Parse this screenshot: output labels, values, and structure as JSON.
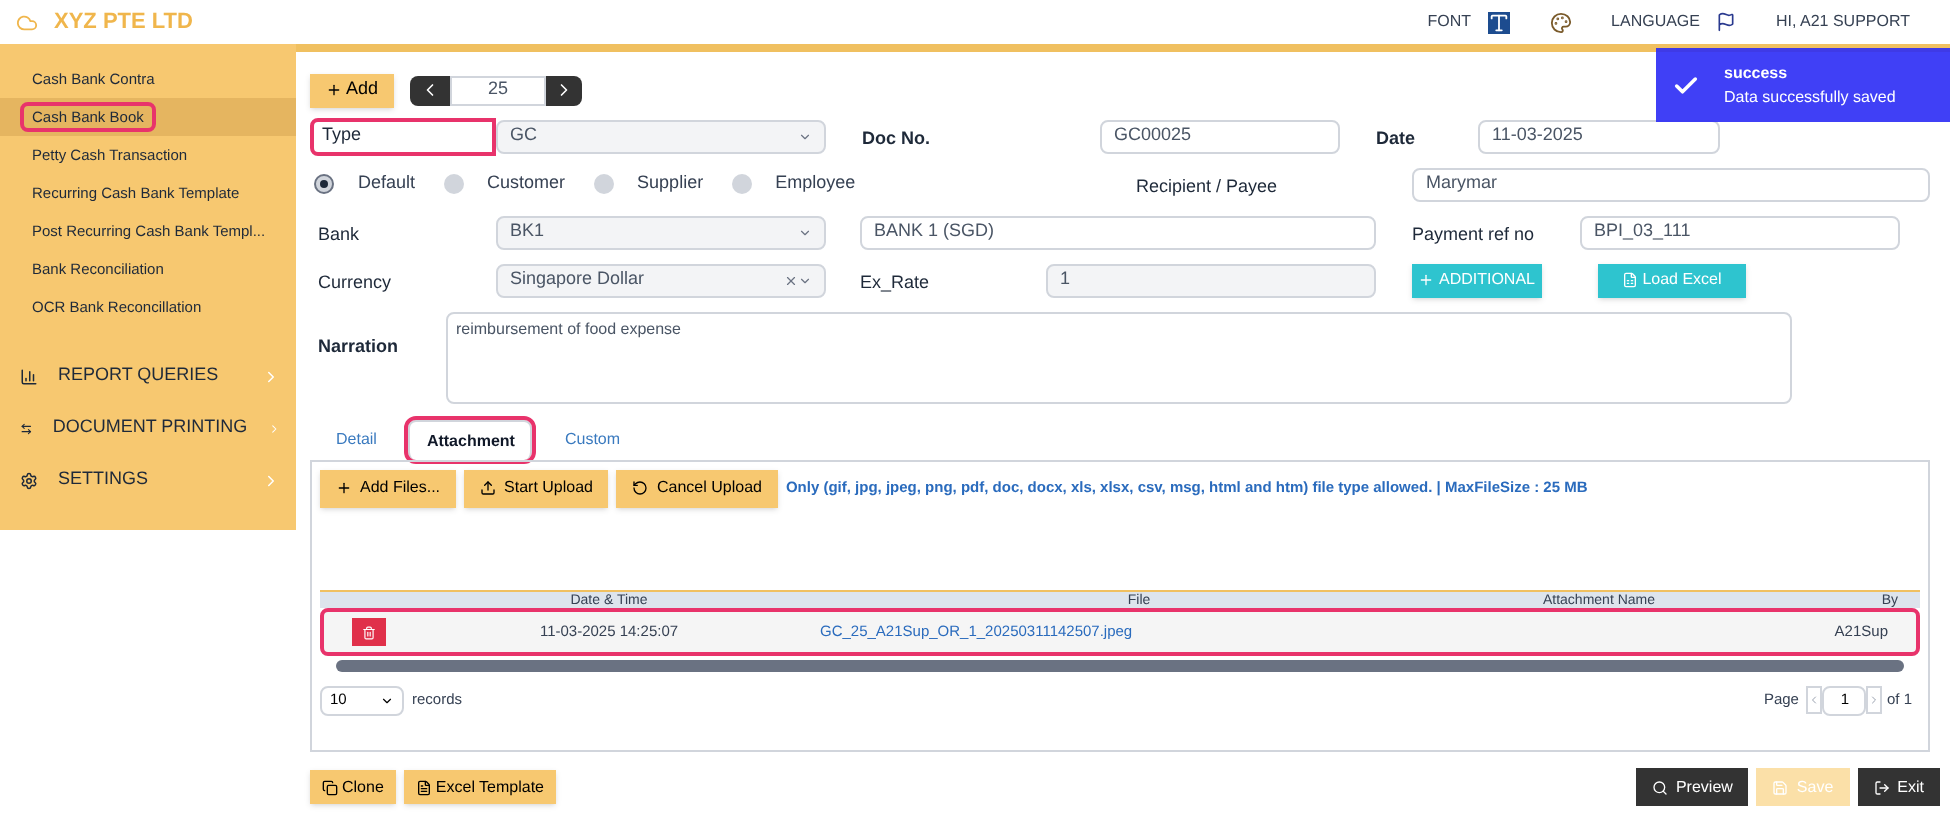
{
  "header": {
    "company": "XYZ PTE LTD",
    "font_label": "FONT",
    "language": "LANGUAGE",
    "user": "HI, A21 SUPPORT"
  },
  "toast": {
    "title": "success",
    "message": "Data successfully saved"
  },
  "sidebar": {
    "items": [
      {
        "label": "Cash Bank Contra",
        "selected": false,
        "highlighted": false
      },
      {
        "label": "Cash Bank Book",
        "selected": true,
        "highlighted": true
      },
      {
        "label": "Petty Cash Transaction",
        "selected": false,
        "highlighted": false
      },
      {
        "label": "Recurring Cash Bank Template",
        "selected": false,
        "highlighted": false
      },
      {
        "label": "Post Recurring Cash Bank Templ...",
        "selected": false,
        "highlighted": false
      },
      {
        "label": "Bank Reconciliation",
        "selected": false,
        "highlighted": false
      },
      {
        "label": "OCR Bank Reconcillation",
        "selected": false,
        "highlighted": false
      }
    ],
    "sections": [
      {
        "label": "REPORT QUERIES",
        "kind": "chart"
      },
      {
        "label": "DOCUMENT PRINTING",
        "kind": "swap"
      },
      {
        "label": "SETTINGS",
        "kind": "gear"
      }
    ]
  },
  "toolbar": {
    "add": "Add",
    "record": "25"
  },
  "form": {
    "type": {
      "label": "Type",
      "value": "GC",
      "highlighted": true
    },
    "doc_no": {
      "label": "Doc No.",
      "value": "GC00025"
    },
    "date": {
      "label": "Date",
      "value": "11-03-2025"
    },
    "radios": [
      {
        "label": "Default",
        "selected": true
      },
      {
        "label": "Customer",
        "selected": false
      },
      {
        "label": "Supplier",
        "selected": false
      },
      {
        "label": "Employee",
        "selected": false
      }
    ],
    "recipient": {
      "label": "Recipient / Payee",
      "value": "Marymar"
    },
    "bank": {
      "label": "Bank",
      "value": "BK1",
      "name": "BANK 1 (SGD)"
    },
    "payment_ref": {
      "label": "Payment ref no",
      "value": "BPI_03_111"
    },
    "currency": {
      "label": "Currency",
      "value": "Singapore Dollar"
    },
    "ex_rate": {
      "label": "Ex_Rate",
      "value": "1"
    },
    "additional": "ADDITIONAL",
    "load_excel": "Load Excel",
    "narration": {
      "label": "Narration",
      "value": "reimbursement of food expense"
    }
  },
  "tabs": [
    {
      "label": "Detail",
      "selected": false,
      "highlighted": false
    },
    {
      "label": "Attachment",
      "selected": true,
      "highlighted": true
    },
    {
      "label": "Custom",
      "selected": false,
      "highlighted": false
    }
  ],
  "upload_buttons": [
    {
      "label": "Add Files...",
      "kind": "add"
    },
    {
      "label": "Start Upload",
      "kind": "upload"
    },
    {
      "label": "Cancel Upload",
      "kind": "cancel"
    }
  ],
  "upload_note": "Only (gif, jpg, jpeg, png, pdf, doc, docx, xls, xlsx, csv, msg, html and htm) file type allowed. | MaxFileSize : 25 MB",
  "table": {
    "columns": [
      "Date & Time",
      "File",
      "Attachment Name",
      "By"
    ],
    "rows": [
      {
        "date": "11-03-2025 14:25:07",
        "file": "GC_25_A21Sup_OR_1_20250311142507.jpeg",
        "by": "A21Sup",
        "highlighted": true
      }
    ]
  },
  "pagination": {
    "page_size": "10",
    "records": "records",
    "page_label": "Page",
    "page": "1",
    "of": "of 1"
  },
  "bottom_left": [
    {
      "label": "Clone",
      "kind": "copy"
    },
    {
      "label": "Excel Template",
      "kind": "file"
    }
  ],
  "bottom_right": [
    {
      "label": "Preview",
      "kind": "search",
      "disabled": false
    },
    {
      "label": "Save",
      "kind": "save",
      "disabled": true
    },
    {
      "label": "Exit",
      "kind": "exit",
      "disabled": false
    }
  ]
}
